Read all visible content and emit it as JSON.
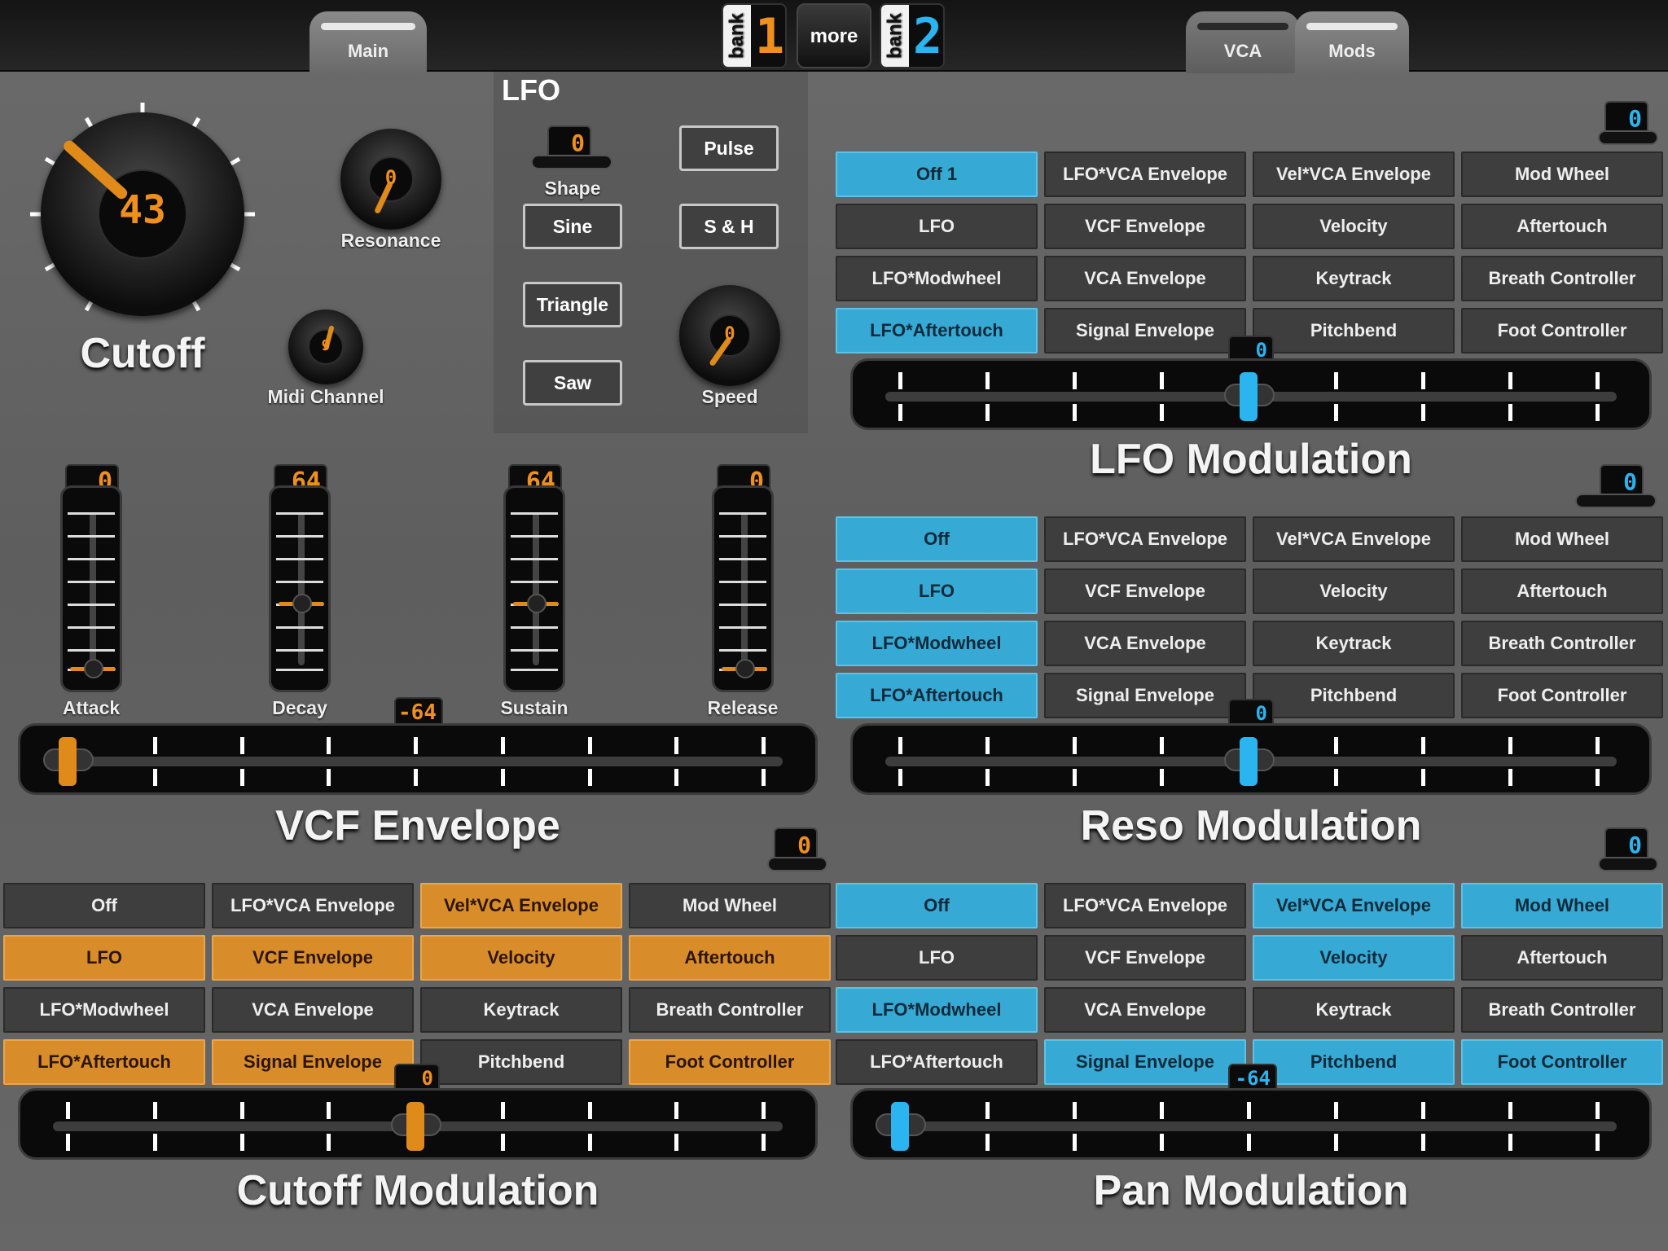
{
  "header": {
    "tab_main": "Main",
    "tab_vca": "VCA",
    "tab_mods": "Mods",
    "bank1": {
      "label": "bank",
      "digit": "1"
    },
    "more": "more",
    "bank2": {
      "label": "bank",
      "digit": "2"
    }
  },
  "main": {
    "cutoff": {
      "label": "Cutoff",
      "value": "43"
    },
    "resonance": {
      "label": "Resonance",
      "value": "0"
    },
    "midi_channel": {
      "label": "Midi Channel",
      "value": "9"
    }
  },
  "lfo": {
    "title": "LFO",
    "shape": {
      "label": "Shape",
      "value": "0"
    },
    "buttons": {
      "pulse": "Pulse",
      "sine": "Sine",
      "sh": "S & H",
      "triangle": "Triangle",
      "saw": "Saw"
    },
    "speed": {
      "label": "Speed",
      "value": "0"
    }
  },
  "envelope": {
    "title": "VCF Envelope",
    "amount": "-64",
    "attack": {
      "label": "Attack",
      "value": "0",
      "level": 0
    },
    "decay": {
      "label": "Decay",
      "value": "64",
      "level": 0.5
    },
    "sustain": {
      "label": "Sustain",
      "value": "64",
      "level": 0.5
    },
    "release": {
      "label": "Release",
      "value": "0",
      "level": 0
    }
  },
  "lfo_mod": {
    "title": "LFO Modulation",
    "counter": "0",
    "amount": "0",
    "cells": [
      "Off 1",
      "LFO*VCA Envelope",
      "Vel*VCA Envelope",
      "Mod Wheel",
      "LFO",
      "VCF Envelope",
      "Velocity",
      "Aftertouch",
      "LFO*Modwheel",
      "VCA Envelope",
      "Keytrack",
      "Breath Controller",
      "LFO*Aftertouch",
      "Signal Envelope",
      "Pitchbend",
      "Foot Controller"
    ]
  },
  "reso_mod": {
    "title": "Reso Modulation",
    "counter": "0",
    "amount": "0",
    "cells": [
      "Off",
      "LFO*VCA Envelope",
      "Vel*VCA Envelope",
      "Mod Wheel",
      "LFO",
      "VCF Envelope",
      "Velocity",
      "Aftertouch",
      "LFO*Modwheel",
      "VCA Envelope",
      "Keytrack",
      "Breath Controller",
      "LFO*Aftertouch",
      "Signal Envelope",
      "Pitchbend",
      "Foot Controller"
    ]
  },
  "cutoff_mod": {
    "title": "Cutoff Modulation",
    "counter": "0",
    "amount": "0",
    "cells": [
      "Off",
      "LFO*VCA Envelope",
      "Vel*VCA Envelope",
      "Mod Wheel",
      "LFO",
      "VCF Envelope",
      "Velocity",
      "Aftertouch",
      "LFO*Modwheel",
      "VCA Envelope",
      "Keytrack",
      "Breath Controller",
      "LFO*Aftertouch",
      "Signal Envelope",
      "Pitchbend",
      "Foot Controller"
    ]
  },
  "pan_mod": {
    "title": "Pan Modulation",
    "counter": "0",
    "amount": "-64",
    "cells": [
      "Off",
      "LFO*VCA Envelope",
      "Vel*VCA Envelope",
      "Mod Wheel",
      "LFO",
      "VCF Envelope",
      "Velocity",
      "Aftertouch",
      "LFO*Modwheel",
      "VCA Envelope",
      "Keytrack",
      "Breath Controller",
      "LFO*Aftertouch",
      "Signal Envelope",
      "Pitchbend",
      "Foot Controller"
    ]
  },
  "colors": {
    "orange": "#d98d2a",
    "blue": "#36aad4",
    "lcd_orange": "#f0901c",
    "lcd_blue": "#2ab4f0"
  }
}
